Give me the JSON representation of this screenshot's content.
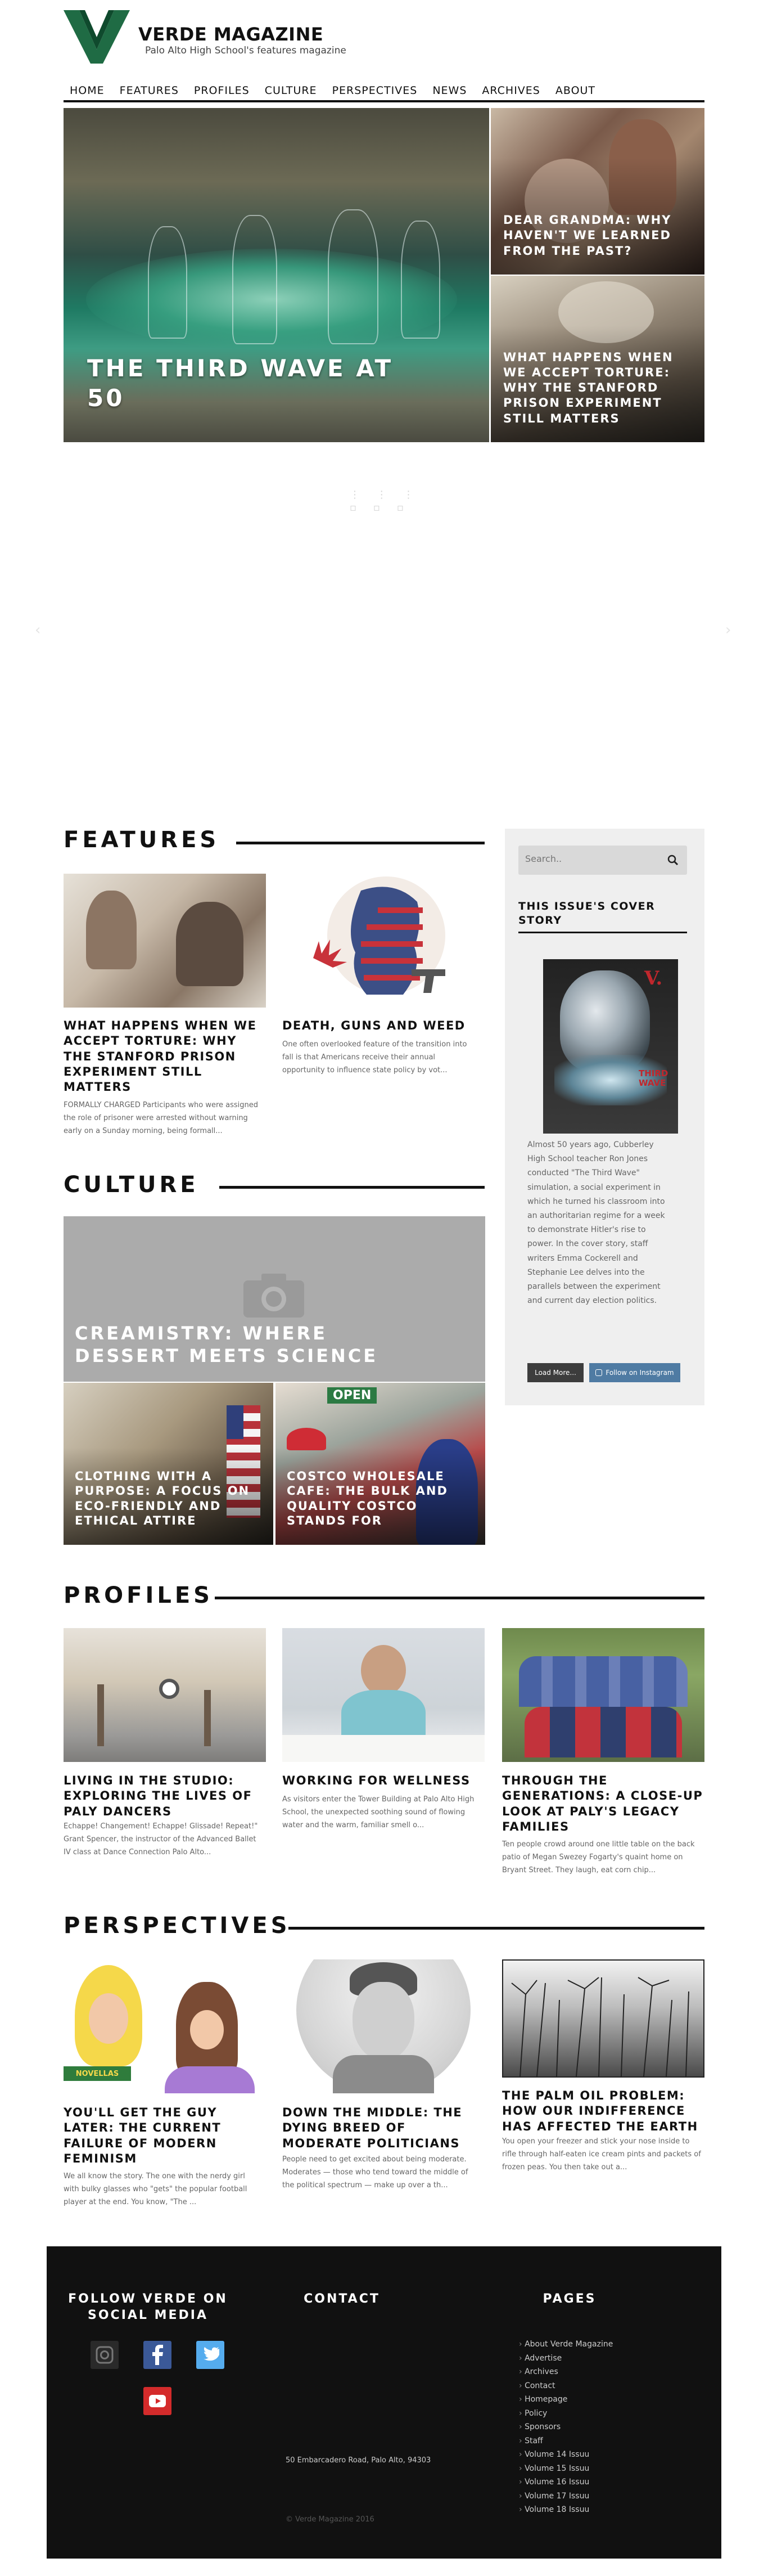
{
  "brand": {
    "title": "VERDE MAGAZINE",
    "tagline": "Palo Alto High School's features magazine",
    "logo_letter": "V"
  },
  "nav": {
    "items": [
      "HOME",
      "FEATURES",
      "PROFILES",
      "CULTURE",
      "PERSPECTIVES",
      "NEWS",
      "ARCHIVES",
      "ABOUT"
    ]
  },
  "hero": {
    "main_title": "THE THIRD WAVE AT 50",
    "side": [
      {
        "title": "DEAR GRANDMA: WHY HAVEN'T WE LEARNED FROM THE PAST?"
      },
      {
        "title": "WHAT HAPPENS WHEN WE ACCEPT TORTURE: WHY THE STANFORD PRISON EXPERIMENT STILL MATTERS"
      }
    ]
  },
  "features": {
    "heading": "FEATURES",
    "cards": [
      {
        "title": "WHAT HAPPENS WHEN WE ACCEPT TORTURE: WHY THE STANFORD PRISON EXPERIMENT STILL MATTERS",
        "excerpt": "FORMALLY CHARGED Participants who were assigned the role of prisoner were arrested without warning early on a Sunday morning, being formall..."
      },
      {
        "title": "DEATH, GUNS AND WEED",
        "excerpt": "One often overlooked feature of the transition into fall is that Americans receive their annual opportunity to influence state policy by vot..."
      }
    ]
  },
  "sidebar": {
    "search_placeholder": "Search..",
    "cover_heading": "THIS ISSUE'S COVER STORY",
    "cover_logo": "V.",
    "cover_title": "THIRD WAVE",
    "cover_text": "Almost 50 years ago, Cubberley High School teacher Ron Jones conducted \"The Third Wave\" simulation, a social experiment in which he turned his classroom into an authoritarian regime for a week to demonstrate Hitler's rise to power. In the cover story, staff writers Emma Cockerell and Stephanie Lee delves into the parallels between the experiment and current day election politics.",
    "load_more": "Load More...",
    "follow_instagram": "Follow on Instagram"
  },
  "culture": {
    "heading": "CULTURE",
    "big_title": "CREAMISTRY: WHERE DESSERT MEETS SCIENCE",
    "small": [
      {
        "title": "CLOTHING WITH A PURPOSE: A FOCUS ON ECO-FRIENDLY AND ETHICAL ATTIRE"
      },
      {
        "title": "COSTCO WHOLESALE CAFE: THE BULK AND QUALITY COSTCO STANDS FOR"
      }
    ],
    "sign_text": "OPEN"
  },
  "profiles": {
    "heading": "PROFILES",
    "cards": [
      {
        "title": "LIVING IN THE STUDIO: EXPLORING THE LIVES OF PALY DANCERS",
        "excerpt": "Echappe! Changement! Echappe! Glissade! Repeat!\" Grant Spencer, the instructor of the Advanced Ballet IV class at Dance Connection Palo Alto..."
      },
      {
        "title": "WORKING FOR WELLNESS",
        "excerpt": "As visitors enter the Tower Building at Palo Alto High School, the unexpected soothing sound of flowing water and the warm, familiar smell o..."
      },
      {
        "title": "THROUGH THE GENERATIONS: A CLOSE-UP LOOK AT PALY'S LEGACY FAMILIES",
        "excerpt": "Ten people crowd around one little table on the back patio of Megan Swezey Fogarty's quaint home on Bryant Street. They laugh, eat corn chip..."
      }
    ]
  },
  "perspectives": {
    "heading": "PERSPECTIVES",
    "cards": [
      {
        "title": "YOU'LL GET THE GUY LATER: THE CURRENT FAILURE OF MODERN FEMINISM",
        "excerpt": "We all know the story. The one with the nerdy girl with bulky glasses who \"gets\" the popular football player at the end. You know, \"The ...",
        "book_label": "NOVELLAS"
      },
      {
        "title": "DOWN THE MIDDLE: THE DYING BREED OF MODERATE POLITICIANS",
        "excerpt": "People need to get excited about being moderate. Moderates — those who tend toward the middle of the political spectrum — make up over a th..."
      },
      {
        "title": "THE PALM OIL PROBLEM: HOW OUR INDIFFERENCE HAS AFFECTED THE EARTH",
        "excerpt": "You open your freezer and stick your nose inside to rifle through half-eaten ice cream pints and packets of frozen peas. You then take out a..."
      }
    ]
  },
  "footer": {
    "follow_heading": "FOLLOW VERDE ON SOCIAL MEDIA",
    "contact_heading": "CONTACT",
    "pages_heading": "PAGES",
    "address": "50 Embarcadero Road, Palo Alto, 94303",
    "copyright": "© Verde Magazine 2016",
    "pages": [
      "About Verde Magazine",
      "Advertise",
      "Archives",
      "Contact",
      "Homepage",
      "Policy",
      "Sponsors",
      "Staff",
      "Volume 14 Issuu",
      "Volume 15 Issuu",
      "Volume 16 Issuu",
      "Volume 17 Issuu",
      "Volume 18 Issuu"
    ]
  },
  "colors": {
    "brand_green": "#1f6b44",
    "text_dark": "#111111",
    "footer_bg": "#111111",
    "instagram_button": "#4f7ba3",
    "facebook": "#3b5998",
    "twitter": "#55acee",
    "youtube": "#d42b2b"
  },
  "icons": [
    "search-icon",
    "camera-icon",
    "instagram-icon",
    "facebook-icon",
    "twitter-icon",
    "youtube-icon",
    "chevron-left-icon",
    "chevron-right-icon"
  ]
}
